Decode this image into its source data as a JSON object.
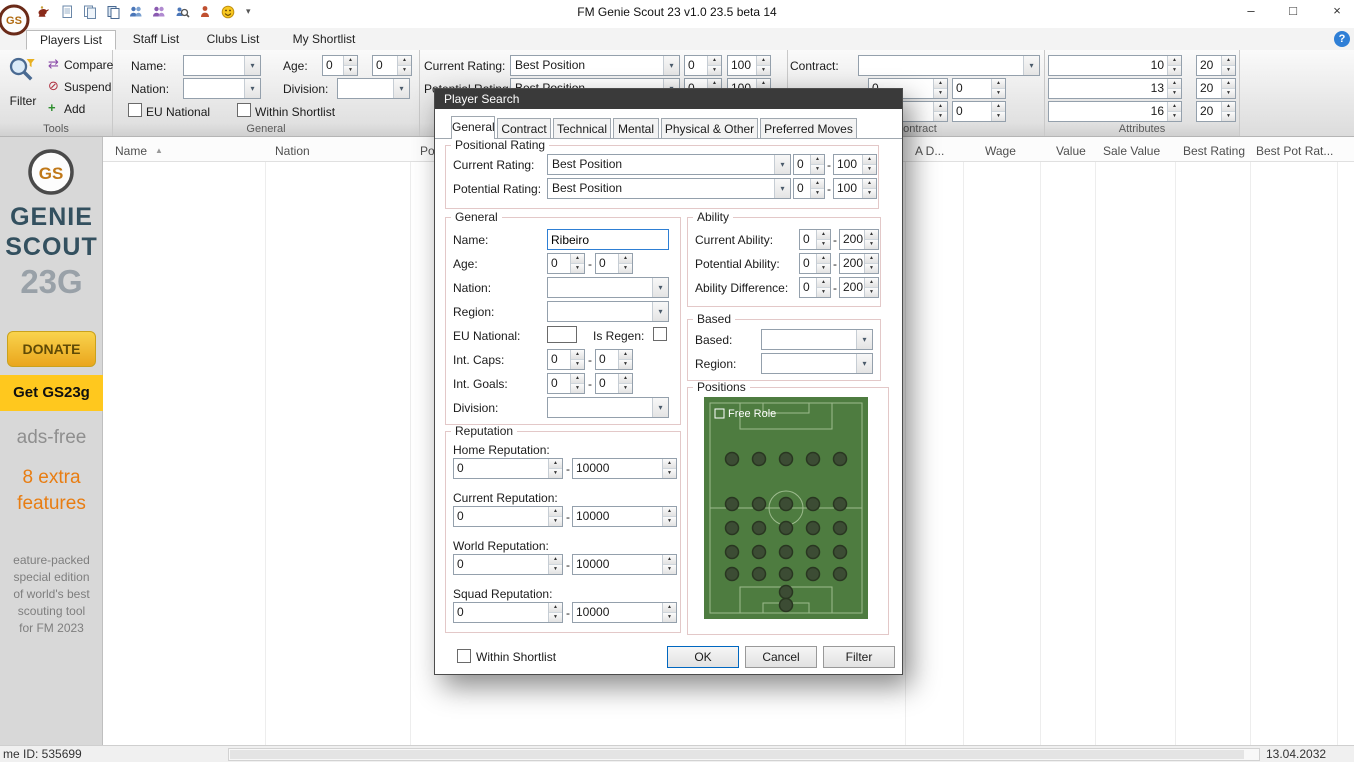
{
  "range_separator": "-",
  "icons": {
    "dropdown_glyph": "▾",
    "spin_up_glyph": "▲",
    "spin_down_glyph": "▼"
  },
  "colors": {
    "dialog_titlebar": "#3a3a3a",
    "pitch_green": "#4e7c40",
    "donate_gold": "#eaa61d",
    "banner_yellow": "#ffc81e",
    "focus_blue": "#2e7fd4",
    "help_blue": "#2f7fd6",
    "orange_text": "#e87d12"
  },
  "titlebar": {
    "title": "FM Genie Scout 23 v1.0 23.5 beta 14",
    "minimize_glyph": "–",
    "maximize_glyph": "□",
    "close_glyph": "×",
    "overflow_glyph": "▾",
    "quick_access_icons": [
      "genie-lamp",
      "new-document",
      "documents",
      "copy",
      "players-group",
      "staff-group",
      "find-player",
      "person",
      "smiley"
    ]
  },
  "tabbar": {
    "help_glyph": "?",
    "tabs": [
      {
        "label": "Players List",
        "active": true
      },
      {
        "label": "Staff List",
        "active": false
      },
      {
        "label": "Clubs List",
        "active": false
      },
      {
        "label": "My Shortlist",
        "active": false
      }
    ]
  },
  "ribbon": {
    "tools": {
      "filter": "Filter",
      "compare": "Compare",
      "suspend": "Suspend",
      "add": "Add",
      "compare_glyph": "⇄",
      "suspend_glyph": "⊘",
      "add_glyph": "+",
      "group_label": "Tools"
    },
    "general": {
      "name_label": "Name:",
      "nation_label": "Nation:",
      "age_label": "Age:",
      "division_label": "Division:",
      "age_min": "0",
      "age_max": "0",
      "eu_national_label": "EU National",
      "within_shortlist_label": "Within Shortlist",
      "group_label": "General"
    },
    "rating": {
      "current_label": "Current Rating:",
      "current_value": "Best Position",
      "current_min": "0",
      "current_max": "100",
      "potential_label": "Potential Rating:",
      "potential_value": "Best Position",
      "potential_min": "0",
      "potential_max": "100"
    },
    "contract": {
      "contract_label": "Contract:",
      "row2_min": "0",
      "row2_max": "0",
      "row3_min": "0",
      "row3_max": "0",
      "group_label": "Contract"
    },
    "attributes": {
      "group_label": "Attributes",
      "rows": [
        {
          "value": "10",
          "max": "20"
        },
        {
          "value": "13",
          "max": "20"
        },
        {
          "value": "16",
          "max": "20"
        }
      ]
    }
  },
  "table": {
    "sort_glyph": "▲",
    "columns": [
      "Name",
      "Nation",
      "Position",
      "A D...",
      "Wage",
      "Value",
      "Sale Value",
      "Best Rating",
      "Best Pot Rat..."
    ]
  },
  "sidebar": {
    "logo_monogram": "GS",
    "brand_line1": "GENIE",
    "brand_line2": "SCOUT",
    "brand_line3": "23G",
    "donate_label": "DONATE",
    "get_label": "Get GS23g",
    "ads_free": "ads-free",
    "extra_line1": "8 extra",
    "extra_line2": "features",
    "description": [
      "eature-packed",
      "special edition",
      "of world's best",
      "scouting tool",
      "for FM 2023"
    ]
  },
  "statusbar": {
    "left": "me ID: 535699",
    "date": "13.04.2032"
  },
  "dialog": {
    "title": "Player Search",
    "tabs": [
      {
        "label": "General",
        "active": true
      },
      {
        "label": "Contract",
        "active": false
      },
      {
        "label": "Technical",
        "active": false
      },
      {
        "label": "Mental",
        "active": false
      },
      {
        "label": "Physical & Other",
        "active": false
      },
      {
        "label": "Preferred Moves",
        "active": false
      }
    ],
    "positional_rating": {
      "group_label": "Positional Rating",
      "current_label": "Current Rating:",
      "current_value": "Best Position",
      "current_min": "0",
      "current_max": "100",
      "potential_label": "Potential Rating:",
      "potential_value": "Best Position",
      "potential_min": "0",
      "potential_max": "100"
    },
    "general": {
      "group_label": "General",
      "name_label": "Name:",
      "name_value": "Ribeiro",
      "age_label": "Age:",
      "age_min": "0",
      "age_max": "0",
      "nation_label": "Nation:",
      "region_label": "Region:",
      "eu_national_label": "EU National:",
      "is_regen_label": "Is Regen:",
      "int_caps_label": "Int. Caps:",
      "int_caps_min": "0",
      "int_caps_max": "0",
      "int_goals_label": "Int. Goals:",
      "int_goals_min": "0",
      "int_goals_max": "0",
      "division_label": "Division:"
    },
    "ability": {
      "group_label": "Ability",
      "rows": [
        {
          "label": "Current Ability:",
          "min": "0",
          "max": "200"
        },
        {
          "label": "Potential Ability:",
          "min": "0",
          "max": "200"
        },
        {
          "label": "Ability Difference:",
          "min": "0",
          "max": "200"
        }
      ]
    },
    "based": {
      "group_label": "Based",
      "based_label": "Based:",
      "region_label": "Region:"
    },
    "positions": {
      "group_label": "Positions",
      "free_role_label": "Free Role"
    },
    "reputation": {
      "group_label": "Reputation",
      "rows": [
        {
          "label": "Home Reputation:",
          "min": "0",
          "max": "10000"
        },
        {
          "label": "Current Reputation:",
          "min": "0",
          "max": "10000"
        },
        {
          "label": "World Reputation:",
          "min": "0",
          "max": "10000"
        },
        {
          "label": "Squad Reputation:",
          "min": "0",
          "max": "10000"
        }
      ]
    },
    "footer": {
      "within_shortlist_label": "Within Shortlist",
      "ok": "OK",
      "cancel": "Cancel",
      "filter": "Filter"
    }
  }
}
